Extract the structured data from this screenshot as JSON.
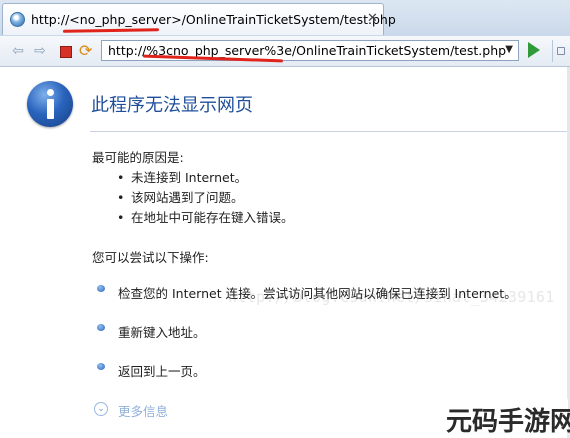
{
  "tab": {
    "title": "http://<no_php_server>/OnlineTrainTicketSystem/test.php",
    "close_glyph": "✕"
  },
  "toolbar": {
    "url": "http://%3cno_php_server%3e/OnlineTrainTicketSystem/test.php",
    "back_icon": "back-arrow-icon",
    "forward_icon": "forward-arrow-icon",
    "stop_icon": "stop-icon",
    "refresh_icon": "refresh-icon",
    "go_icon": "go-icon"
  },
  "page": {
    "title": "此程序无法显示网页",
    "causes_heading": "最可能的原因是:",
    "causes": [
      "未连接到 Internet。",
      "该网站遇到了问题。",
      "在地址中可能存在键入错误。"
    ],
    "try_heading": "您可以尝试以下操作:",
    "suggestions": [
      "检查您的 Internet 连接。尝试访问其他网站以确保已连接到 Internet。",
      "重新键入地址。",
      "返回到上一页。"
    ],
    "more_info": "更多信息"
  },
  "watermark": "http://blog.csdn.net/sinat_34239161",
  "logo_text": "元码手游网",
  "colors": {
    "title_blue": "#1f4f9a",
    "underline_red": "#e0241c",
    "go_green": "#2f9a38",
    "more_info_blue": "#8fb0d8"
  }
}
